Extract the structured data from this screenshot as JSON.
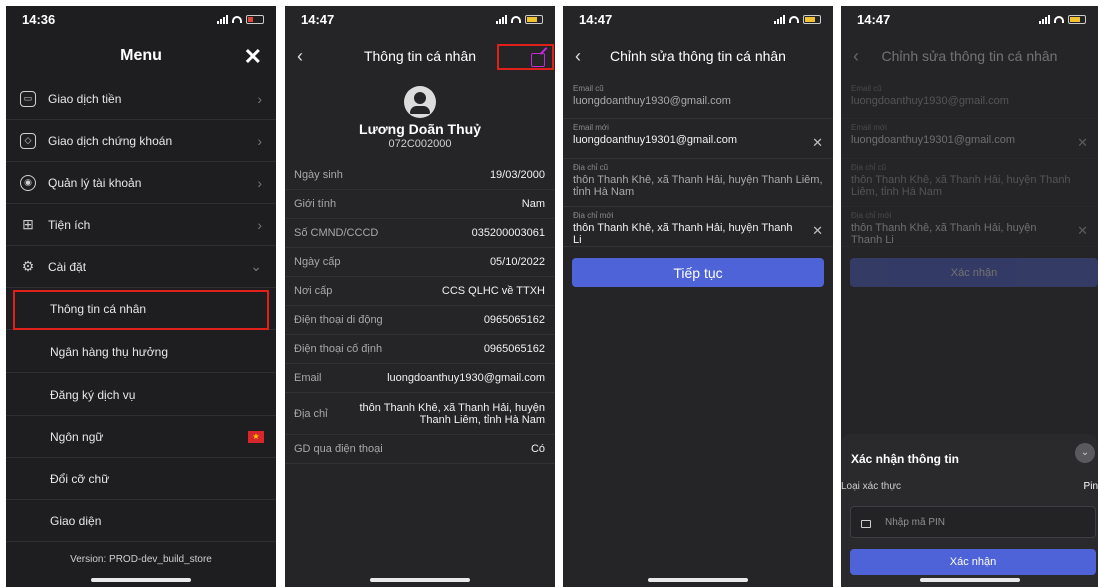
{
  "screen1": {
    "time": "14:36",
    "title": "Menu",
    "close_label": "✕",
    "items": [
      {
        "label": "Giao dịch tiền",
        "icon": "wallet-icon",
        "glyph": "▭"
      },
      {
        "label": "Giao dịch chứng khoán",
        "icon": "tag-icon",
        "glyph": "◇"
      },
      {
        "label": "Quản lý tài khoản",
        "icon": "user-icon",
        "glyph": "◉"
      },
      {
        "label": "Tiện ích",
        "icon": "apps-icon",
        "glyph": "⊞"
      },
      {
        "label": "Cài đặt",
        "icon": "gear-icon",
        "glyph": "⚙"
      }
    ],
    "sub_items": [
      "Thông tin cá nhân",
      "Ngân hàng thụ hưởng",
      "Đăng ký dịch vụ",
      "Ngôn ngữ",
      "Đổi cỡ chữ",
      "Giao diện"
    ],
    "flag_glyph": "★",
    "version": "Version: PROD-dev_build_store"
  },
  "screen2": {
    "time": "14:47",
    "title": "Thông tin cá nhân",
    "name": "Lương Doãn Thuỷ",
    "account_id": "072C002000",
    "rows": [
      {
        "k": "Ngày sinh",
        "v": "19/03/2000"
      },
      {
        "k": "Giới tính",
        "v": "Nam"
      },
      {
        "k": "Số CMND/CCCD",
        "v": "035200003061"
      },
      {
        "k": "Ngày cấp",
        "v": "05/10/2022"
      },
      {
        "k": "Nơi cấp",
        "v": "CCS QLHC về TTXH"
      },
      {
        "k": "Điện thoại di động",
        "v": "0965065162"
      },
      {
        "k": "Điện thoại cố định",
        "v": "0965065162"
      },
      {
        "k": "Email",
        "v": "luongdoanthuy1930@gmail.com"
      },
      {
        "k": "Địa chỉ",
        "v": "thôn Thanh Khê, xã Thanh Hải, huyện Thanh Liêm, tỉnh Hà Nam"
      },
      {
        "k": "GD qua điện thoại",
        "v": "Có"
      }
    ]
  },
  "screen3": {
    "time": "14:47",
    "title": "Chỉnh sửa thông tin cá nhân",
    "old_email_label": "Email cũ",
    "old_email": "luongdoanthuy1930@gmail.com",
    "new_email_label": "Email mới",
    "new_email": "luongdoanthuy19301@gmail.com",
    "old_address_label": "Địa chỉ cũ",
    "old_address": "thôn Thanh Khê, xã Thanh Hải, huyện Thanh Liêm, tỉnh Hà Nam",
    "new_address_label": "Địa chỉ mới",
    "new_address": "thôn Thanh Khê, xã Thanh Hải, huyện Thanh Li",
    "continue_label": "Tiếp tục"
  },
  "screen4": {
    "time": "14:47",
    "title": "Chỉnh sửa thông tin cá nhân",
    "confirm_bg_label": "Xác nhận",
    "sheet_title": "Xác nhận thông tin",
    "auth_type_label": "Loại xác thực",
    "auth_type_value": "Pin",
    "pin_placeholder": "Nhập mã PIN",
    "confirm_label": "Xác nhận"
  },
  "colors": {
    "accent": "#4f63d8",
    "highlight": "#e0201a",
    "edit": "#c32ad6"
  }
}
